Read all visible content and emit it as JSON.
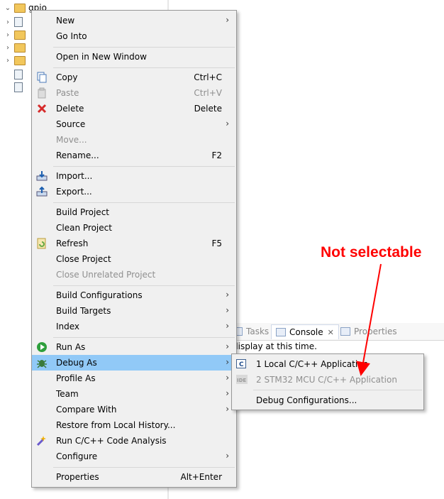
{
  "tree": {
    "root_label": "gpio"
  },
  "menu": {
    "items": [
      {
        "label": "New",
        "shortcut": "",
        "arrow": true,
        "disabled": false,
        "icon": ""
      },
      {
        "label": "Go Into",
        "shortcut": "",
        "arrow": false,
        "disabled": false,
        "icon": ""
      },
      {
        "label": "Open in New Window",
        "shortcut": "",
        "arrow": false,
        "disabled": false,
        "icon": ""
      },
      {
        "label": "Copy",
        "shortcut": "Ctrl+C",
        "arrow": false,
        "disabled": false,
        "icon": "copy-icon"
      },
      {
        "label": "Paste",
        "shortcut": "Ctrl+V",
        "arrow": false,
        "disabled": true,
        "icon": "paste-icon"
      },
      {
        "label": "Delete",
        "shortcut": "Delete",
        "arrow": false,
        "disabled": false,
        "icon": "delete-icon"
      },
      {
        "label": "Source",
        "shortcut": "",
        "arrow": true,
        "disabled": false,
        "icon": ""
      },
      {
        "label": "Move...",
        "shortcut": "",
        "arrow": false,
        "disabled": true,
        "icon": ""
      },
      {
        "label": "Rename...",
        "shortcut": "F2",
        "arrow": false,
        "disabled": false,
        "icon": ""
      },
      {
        "label": "Import...",
        "shortcut": "",
        "arrow": false,
        "disabled": false,
        "icon": "import-icon"
      },
      {
        "label": "Export...",
        "shortcut": "",
        "arrow": false,
        "disabled": false,
        "icon": "export-icon"
      },
      {
        "label": "Build Project",
        "shortcut": "",
        "arrow": false,
        "disabled": false,
        "icon": ""
      },
      {
        "label": "Clean Project",
        "shortcut": "",
        "arrow": false,
        "disabled": false,
        "icon": ""
      },
      {
        "label": "Refresh",
        "shortcut": "F5",
        "arrow": false,
        "disabled": false,
        "icon": "refresh-icon"
      },
      {
        "label": "Close Project",
        "shortcut": "",
        "arrow": false,
        "disabled": false,
        "icon": ""
      },
      {
        "label": "Close Unrelated Project",
        "shortcut": "",
        "arrow": false,
        "disabled": true,
        "icon": ""
      },
      {
        "label": "Build Configurations",
        "shortcut": "",
        "arrow": true,
        "disabled": false,
        "icon": ""
      },
      {
        "label": "Build Targets",
        "shortcut": "",
        "arrow": true,
        "disabled": false,
        "icon": ""
      },
      {
        "label": "Index",
        "shortcut": "",
        "arrow": true,
        "disabled": false,
        "icon": ""
      },
      {
        "label": "Run As",
        "shortcut": "",
        "arrow": true,
        "disabled": false,
        "icon": "run-icon"
      },
      {
        "label": "Debug As",
        "shortcut": "",
        "arrow": true,
        "disabled": false,
        "icon": "debug-icon",
        "highlighted": true
      },
      {
        "label": "Profile As",
        "shortcut": "",
        "arrow": true,
        "disabled": false,
        "icon": ""
      },
      {
        "label": "Team",
        "shortcut": "",
        "arrow": true,
        "disabled": false,
        "icon": ""
      },
      {
        "label": "Compare With",
        "shortcut": "",
        "arrow": true,
        "disabled": false,
        "icon": ""
      },
      {
        "label": "Restore from Local History...",
        "shortcut": "",
        "arrow": false,
        "disabled": false,
        "icon": ""
      },
      {
        "label": "Run C/C++ Code Analysis",
        "shortcut": "",
        "arrow": false,
        "disabled": false,
        "icon": "code-analysis-icon"
      },
      {
        "label": "Configure",
        "shortcut": "",
        "arrow": true,
        "disabled": false,
        "icon": ""
      },
      {
        "label": "Properties",
        "shortcut": "Alt+Enter",
        "arrow": false,
        "disabled": false,
        "icon": ""
      }
    ]
  },
  "submenu": {
    "items": [
      {
        "label": "1 Local C/C++ Application",
        "disabled": false,
        "icon": "c-app-icon"
      },
      {
        "label": "2 STM32 MCU C/C++ Application",
        "disabled": true,
        "icon": "ide-icon"
      },
      {
        "label": "Debug Configurations...",
        "disabled": false,
        "icon": ""
      }
    ]
  },
  "bottom_view": {
    "tabs": [
      "Tasks",
      "Console",
      "Properties"
    ],
    "console_message": "display at this time."
  },
  "annotation": {
    "text": "Not selectable",
    "color": "#ff0000"
  }
}
